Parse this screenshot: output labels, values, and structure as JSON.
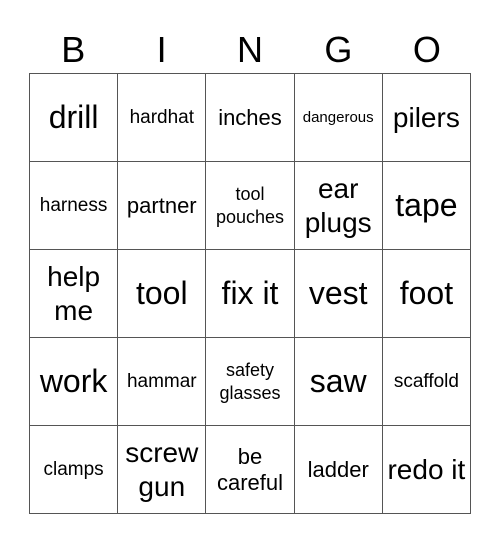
{
  "header": {
    "letters": [
      "B",
      "I",
      "N",
      "G",
      "O"
    ]
  },
  "grid": {
    "rows": [
      [
        {
          "text": "drill",
          "size": "xl"
        },
        {
          "text": "hardhat",
          "size": "sm"
        },
        {
          "text": "inches",
          "size": "md"
        },
        {
          "text": "dangerous",
          "size": "xxs"
        },
        {
          "text": "pilers",
          "size": "lg"
        }
      ],
      [
        {
          "text": "harness",
          "size": "sm"
        },
        {
          "text": "partner",
          "size": "md"
        },
        {
          "text": "tool pouches",
          "size": "xs"
        },
        {
          "text": "ear plugs",
          "size": "lg"
        },
        {
          "text": "tape",
          "size": "xl"
        }
      ],
      [
        {
          "text": "help me",
          "size": "lg"
        },
        {
          "text": "tool",
          "size": "xl"
        },
        {
          "text": "fix it",
          "size": "xl"
        },
        {
          "text": "vest",
          "size": "xl"
        },
        {
          "text": "foot",
          "size": "xl"
        }
      ],
      [
        {
          "text": "work",
          "size": "xl"
        },
        {
          "text": "hammar",
          "size": "sm"
        },
        {
          "text": "safety glasses",
          "size": "xs"
        },
        {
          "text": "saw",
          "size": "xl"
        },
        {
          "text": "scaffold",
          "size": "sm"
        }
      ],
      [
        {
          "text": "clamps",
          "size": "sm"
        },
        {
          "text": "screw gun",
          "size": "lg"
        },
        {
          "text": "be careful",
          "size": "md"
        },
        {
          "text": "ladder",
          "size": "md"
        },
        {
          "text": "redo it",
          "size": "lg"
        }
      ]
    ]
  }
}
